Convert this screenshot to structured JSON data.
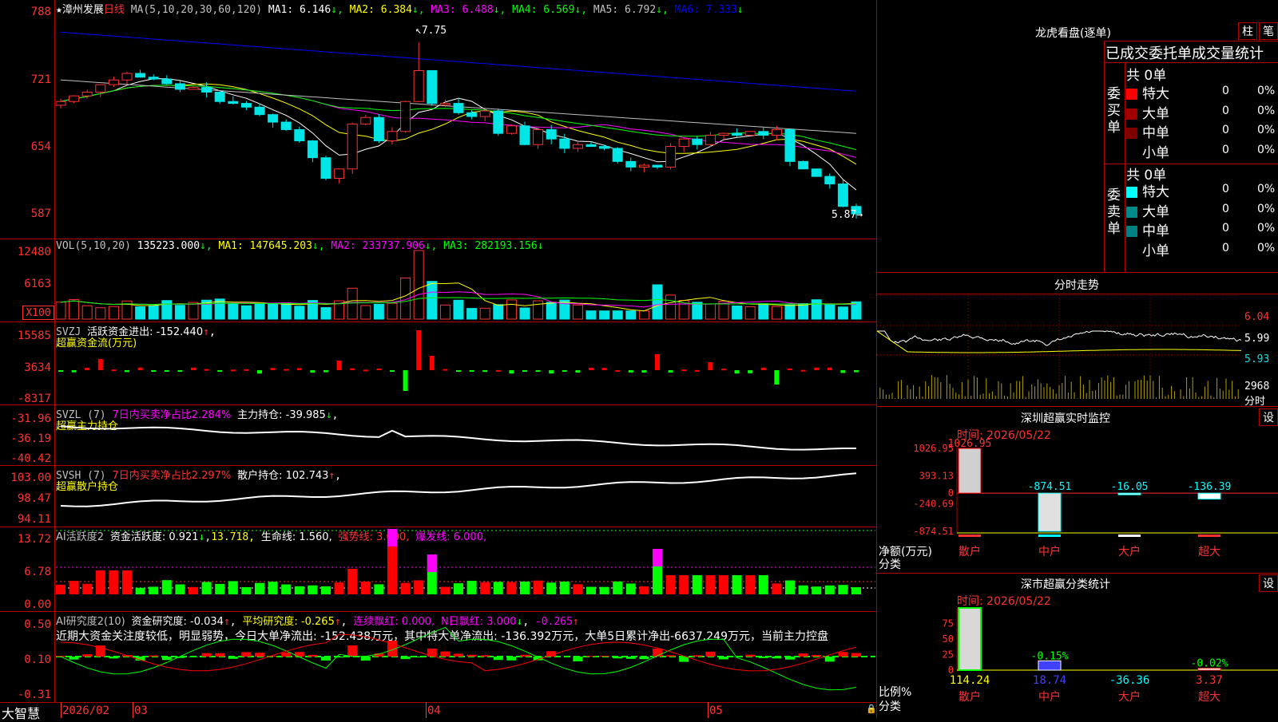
{
  "stock": {
    "name": "漳州发展",
    "period": "日线"
  },
  "colors": {
    "up": "#ff3232",
    "down": "#00e5e5",
    "grid": "#b00000"
  },
  "price_panel": {
    "ma_label": "MA(5,10,20,30,60,120)",
    "ma": [
      {
        "label": "MA1:",
        "value": "6.146",
        "arrow": "↓",
        "color": "#ffffff"
      },
      {
        "label": "MA2:",
        "value": "6.384",
        "arrow": "↓",
        "color": "#ffff00"
      },
      {
        "label": "MA3:",
        "value": "6.488",
        "arrow": "↓",
        "color": "#ff00ff"
      },
      {
        "label": "MA4:",
        "value": "6.569",
        "arrow": "↓",
        "color": "#00ff00"
      },
      {
        "label": "MA5:",
        "value": "6.792",
        "arrow": "↓",
        "color": "#c0c0c0"
      },
      {
        "label": "MA6:",
        "value": "7.333",
        "arrow": "↓",
        "color": "#0000ff"
      }
    ],
    "y_ticks": [
      "788",
      "721",
      "654",
      "587"
    ],
    "high_mark": "7.75",
    "low_mark": "5.87"
  },
  "vol_panel": {
    "title": "VOL(5,10,20)",
    "value": "135223.000",
    "ma": [
      {
        "label": "MA1:",
        "value": "147645.203",
        "arrow": "↓",
        "color": "#ffff00"
      },
      {
        "label": "MA2:",
        "value": "233737.906",
        "arrow": "↓",
        "color": "#ff00ff"
      },
      {
        "label": "MA3:",
        "value": "282193.156",
        "arrow": "↓",
        "color": "#00ff00"
      }
    ],
    "y_ticks": [
      "12480",
      "6163"
    ],
    "unit_badge": "X100"
  },
  "svzj_panel": {
    "title": "SVZJ",
    "line1": "活跃资金进出: -152.440",
    "arrow": "↑",
    "line2": "超赢资金流(万元)",
    "y_ticks": [
      "15585",
      "3634",
      "-8317"
    ]
  },
  "svzl_panel": {
    "title": "SVZL (7)",
    "ratio": "7日内买卖净占比2.284%",
    "hold": "主力持仓: -39.985",
    "arrow": "↓",
    "line2": "超赢主力持仓",
    "y_ticks": [
      "-31.96",
      "-36.19",
      "-40.42"
    ]
  },
  "svsh_panel": {
    "title": "SVSH (7)",
    "ratio": "7日内买卖净占比2.297%",
    "hold": "散户持仓: 102.743",
    "arrow": "↑",
    "line2": "超赢散户持仓",
    "y_ticks": [
      "103.00",
      "98.47",
      "94.11"
    ]
  },
  "ai_act_panel": {
    "title": "AI活跃度2",
    "act": "资金活跃度: 0.921",
    "act_arrow": "↓",
    "v2": "13.718,",
    "life": "生命线: 1.560,",
    "strong": "强势线: 3.000,",
    "burst": "爆发线: 6.000,",
    "y_ticks": [
      "13.72",
      "6.78",
      "0.00"
    ]
  },
  "ai_res_panel": {
    "title": "AI研究度2(10)",
    "res": "资金研究度: -0.034",
    "res_arrow": "↑",
    "avg": "平均研究度: -0.265",
    "avg_arrow": "↑",
    "cont": "连续飘红: 0.000,",
    "n": "N日飘红: 3.000",
    "n_arrow": "↓",
    "last": "-0.265",
    "last_arrow": "↑",
    "comment": "近期大资金关注度较低，明显弱势，今日大单净流出: -152.438万元，其中特大单净流出: -136.392万元，大单5日累计净出-6637.249万元，当前主力控盘",
    "y_ticks": [
      "0.50",
      "0.10",
      "-0.31"
    ]
  },
  "date_axis": {
    "brand": "大智慧",
    "labels": [
      "2026/02",
      "03",
      "04",
      "05"
    ]
  },
  "dragon": {
    "title": "龙虎看盘(逐单)",
    "btn_bar": "柱",
    "btn_pen": "笔",
    "stat_title": "已成交委托单成交量统计",
    "buy_label": "委买单",
    "sell_label": "委卖单",
    "buy_total": "共 0单",
    "sell_total": "共 0单",
    "rows": [
      {
        "label": "特大",
        "v": "0",
        "p": "0%"
      },
      {
        "label": "大单",
        "v": "0",
        "p": "0%"
      },
      {
        "label": "中单",
        "v": "0",
        "p": "0%"
      },
      {
        "label": "小单",
        "v": "0",
        "p": "0%"
      }
    ],
    "buy_colors": [
      "#ff0000",
      "#a00000",
      "#800000",
      ""
    ],
    "sell_colors": [
      "#00ffff",
      "#008b8b",
      "#008080",
      ""
    ]
  },
  "intraday": {
    "title": "分时走势",
    "y_ticks": [
      "6.04",
      "5.99",
      "5.93"
    ],
    "vol_tick": "2968",
    "unit": "分时"
  },
  "sz_monitor": {
    "title": "深圳超赢实时监控",
    "btn": "设",
    "time": "时间: 2026/05/22",
    "y_ticks": [
      "1026.95",
      "393.13",
      "0",
      "-240.69",
      "-874.51"
    ],
    "ylabel": "净额(万元)",
    "xlabel": "分类",
    "chart_data": {
      "type": "bar",
      "categories": [
        "散户",
        "中户",
        "大户",
        "超大"
      ],
      "values": [
        1026.95,
        -874.51,
        -16.05,
        -136.39
      ],
      "labels": [
        "1026.95",
        "-874.51",
        "-16.05",
        "-136.39"
      ],
      "ylim": [
        -874.51,
        1026.95
      ]
    }
  },
  "sz_class": {
    "title": "深市超赢分类统计",
    "btn": "设",
    "time": "时间: 2026/05/22",
    "y_ticks": [
      "75",
      "50",
      "25",
      "0"
    ],
    "ylabel": "比例%",
    "xlabel": "分类",
    "chart_data": {
      "type": "bar",
      "categories": [
        "散户",
        "中户",
        "大户",
        "超大"
      ],
      "values": [
        114.24,
        18.74,
        -36.36,
        3.37
      ],
      "pct_labels": [
        "",
        "-0.15%",
        "",
        "-0.02%"
      ],
      "value_labels": [
        "114.24",
        "18.74",
        "-36.36",
        "3.37"
      ],
      "ylim": [
        0,
        100
      ]
    }
  }
}
